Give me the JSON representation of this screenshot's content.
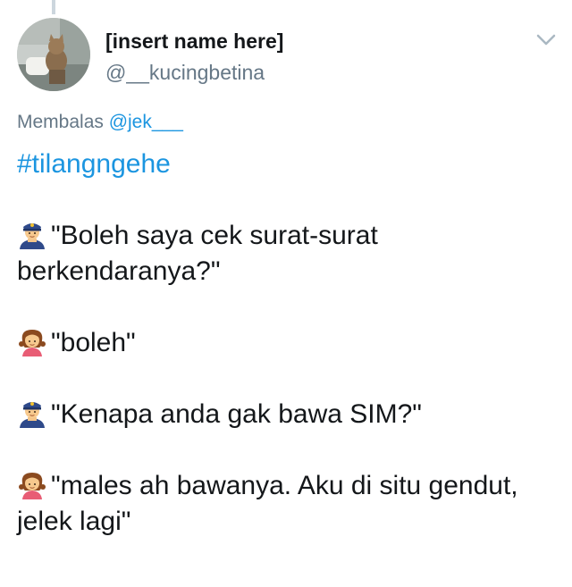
{
  "tweet": {
    "display_name": "[insert name here]",
    "handle": "@__kucingbetina",
    "reply_prefix": "Membalas ",
    "reply_to": "@jek___",
    "hashtag": "#tilangngehe",
    "lines": [
      {
        "speaker": "police-officer-icon",
        "text": "\"Boleh saya cek surat-surat berkendaranya?\""
      },
      {
        "speaker": "girl-icon",
        "text": "\"boleh\""
      },
      {
        "speaker": "police-officer-icon",
        "text": "\"Kenapa anda gak bawa SIM?\""
      },
      {
        "speaker": "girl-icon",
        "text": "\"males ah bawanya. Aku di situ gendut, jelek lagi\""
      }
    ]
  },
  "icons": {
    "menu": "chevron-down-icon",
    "avatar": "cat-avatar"
  },
  "colors": {
    "link": "#1b95e0",
    "secondary_text": "#657786",
    "primary_text": "#14171a",
    "thread_line": "#ccd6dd"
  }
}
